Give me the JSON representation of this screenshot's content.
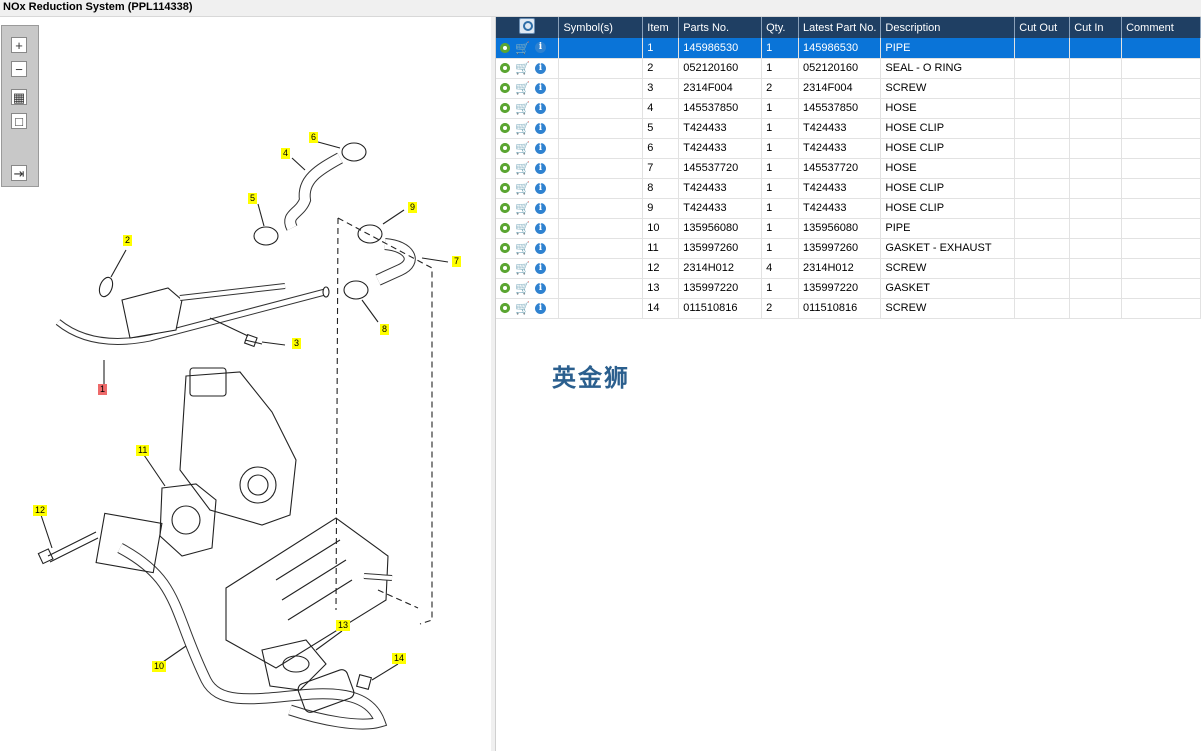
{
  "window": {
    "title": "NOx Reduction System (PPL114338)"
  },
  "toolbar": {
    "zoom_in": "+",
    "zoom_out": "−",
    "fit": "▦",
    "reset": "□",
    "export": "⇥"
  },
  "callouts": {
    "c1": "1",
    "c2": "2",
    "c3": "3",
    "c4": "4",
    "c5": "5",
    "c6": "6",
    "c7": "7",
    "c8": "8",
    "c9": "9",
    "c10": "10",
    "c11": "11",
    "c12": "12",
    "c13": "13",
    "c14": "14"
  },
  "watermark": "英金狮",
  "colors": {
    "header_bg": "#1f3f63",
    "selected_row": "#0a74d8",
    "callout": "#ffff00",
    "callout_selected": "#ee6a6a"
  },
  "icons": {
    "row_icons": [
      "gear-icon",
      "cart-icon",
      "info-icon"
    ],
    "header_icon": "find-icon"
  },
  "table": {
    "headers": {
      "symbols": "Symbol(s)",
      "item": "Item",
      "parts_no": "Parts No.",
      "qty": "Qty.",
      "latest": "Latest Part No.",
      "desc": "Description",
      "cut_out": "Cut Out",
      "cut_in": "Cut In",
      "comment": "Comment"
    },
    "rows": [
      {
        "item": "1",
        "parts_no": "145986530",
        "qty": "1",
        "latest": "145986530",
        "desc": "PIPE"
      },
      {
        "item": "2",
        "parts_no": "052120160",
        "qty": "1",
        "latest": "052120160",
        "desc": "SEAL - O RING"
      },
      {
        "item": "3",
        "parts_no": "2314F004",
        "qty": "2",
        "latest": "2314F004",
        "desc": "SCREW"
      },
      {
        "item": "4",
        "parts_no": "145537850",
        "qty": "1",
        "latest": "145537850",
        "desc": "HOSE"
      },
      {
        "item": "5",
        "parts_no": "T424433",
        "qty": "1",
        "latest": "T424433",
        "desc": "HOSE CLIP"
      },
      {
        "item": "6",
        "parts_no": "T424433",
        "qty": "1",
        "latest": "T424433",
        "desc": "HOSE CLIP"
      },
      {
        "item": "7",
        "parts_no": "145537720",
        "qty": "1",
        "latest": "145537720",
        "desc": "HOSE"
      },
      {
        "item": "8",
        "parts_no": "T424433",
        "qty": "1",
        "latest": "T424433",
        "desc": "HOSE CLIP"
      },
      {
        "item": "9",
        "parts_no": "T424433",
        "qty": "1",
        "latest": "T424433",
        "desc": "HOSE CLIP"
      },
      {
        "item": "10",
        "parts_no": "135956080",
        "qty": "1",
        "latest": "135956080",
        "desc": "PIPE"
      },
      {
        "item": "11",
        "parts_no": "135997260",
        "qty": "1",
        "latest": "135997260",
        "desc": "GASKET - EXHAUST"
      },
      {
        "item": "12",
        "parts_no": "2314H012",
        "qty": "4",
        "latest": "2314H012",
        "desc": "SCREW"
      },
      {
        "item": "13",
        "parts_no": "135997220",
        "qty": "1",
        "latest": "135997220",
        "desc": "GASKET"
      },
      {
        "item": "14",
        "parts_no": "011510816",
        "qty": "2",
        "latest": "011510816",
        "desc": "SCREW"
      }
    ]
  }
}
